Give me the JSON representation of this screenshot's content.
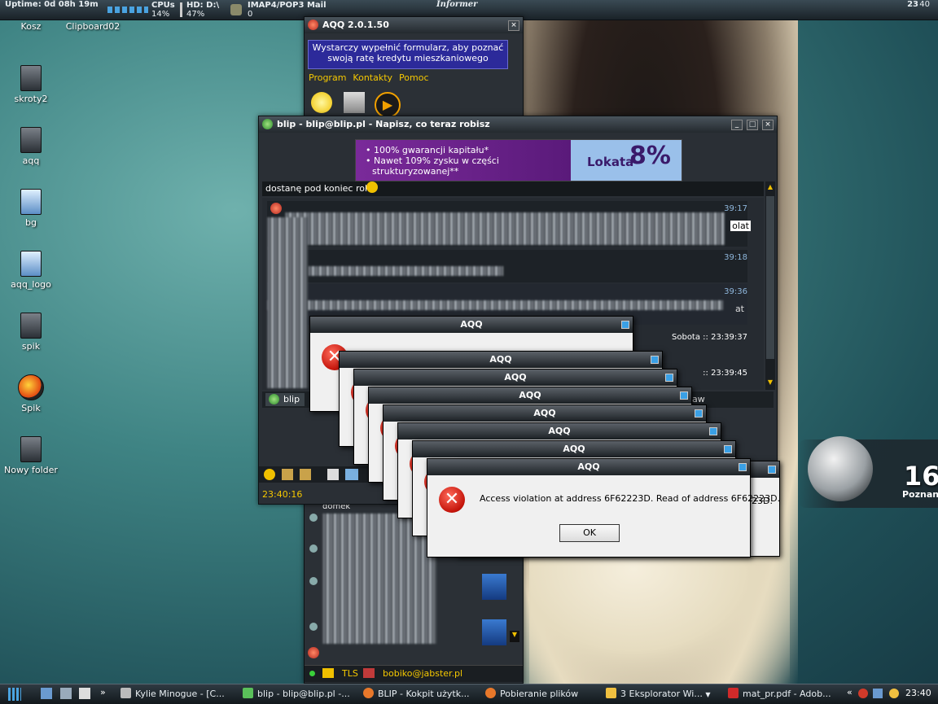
{
  "topbar": {
    "uptime": "Uptime: 0d 08h 19m",
    "cpus_label": "CPUs",
    "cpus_value": "14%",
    "hd_label": "HD: D:\\",
    "hd_value": "47%",
    "mail_label": "IMAP4/POP3 Mail",
    "mail_value": "0",
    "informer": "Informer",
    "clock_hour": "23",
    "clock_min": "40"
  },
  "desktop_icons": [
    "Kosz",
    "Clipboard02",
    "skroty2",
    "aqq",
    "bg",
    "aqq_logo",
    "spik",
    "Spik",
    "Nowy folder"
  ],
  "aqq_main": {
    "title": "AQQ 2.0.1.50",
    "banner": "Wystarczy wypełnić formularz, aby poznać swoją ratę kredytu mieszkaniowego",
    "menu": [
      "Program",
      "Kontakty",
      "Pomoc"
    ],
    "contact_sub": "domek",
    "status_tls": "TLS",
    "status_account": "bobiko@jabster.pl"
  },
  "blip": {
    "title": "blip - blip@blip.pl - Napisz, co teraz robisz",
    "ad_lines": [
      "• 100% gwarancji kapitału*",
      "• Nawet 109% zysku w części",
      "strukturyzowanej**"
    ],
    "ad_brand": "Lokata",
    "ad_rate": "8%",
    "header_msg": "dostanę pod koniec roku",
    "times": [
      "39:17",
      "39:18",
      "39:36",
      "Sobota :: 23:39:37",
      ":: 23:39:45"
    ],
    "snippets": [
      "olat",
      "at"
    ],
    "tab_label": "blip",
    "tab_other": "aw",
    "status_time": "23:40:16"
  },
  "dialogs": {
    "title": "AQQ",
    "message": "Access violation at address 6F62223D. Read of address 6F62223D.",
    "partial_message": "23D.",
    "ok": "OK"
  },
  "weather": {
    "temp": "16",
    "location": "Poznan"
  },
  "taskbar": {
    "items": [
      "Kylie Minogue - [C...",
      "blip - blip@blip.pl -...",
      "BLIP - Kokpit użytk...",
      "Pobieranie plików",
      "3 Eksplorator Wi...",
      "mat_pr.pdf - Adob..."
    ],
    "clock": "23:40",
    "chevron": "»",
    "tray_chevron": "«"
  }
}
